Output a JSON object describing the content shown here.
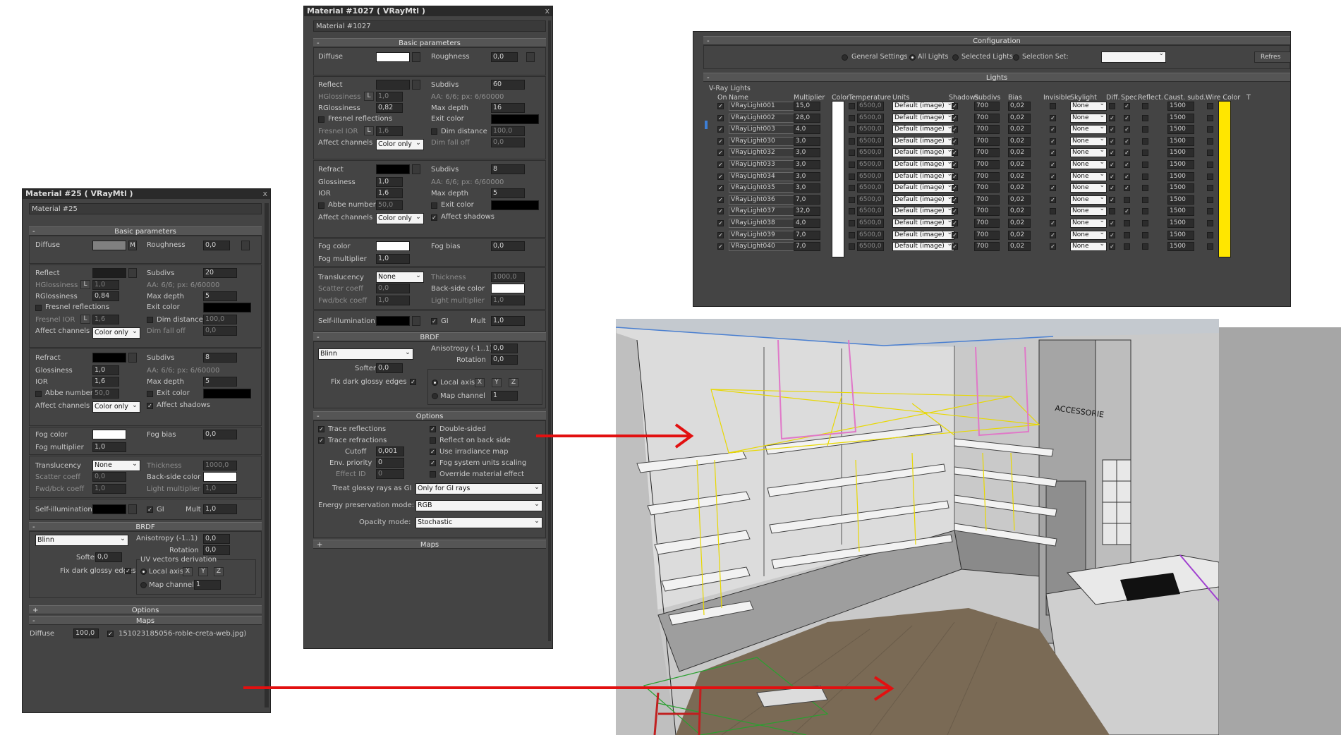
{
  "material25": {
    "title": "Material #25  ( VRayMtl )",
    "close": "x",
    "name": "Material #25",
    "basic_parameters": "Basic parameters",
    "diffuse": "Diffuse",
    "diffuse_map": "M",
    "roughness": "Roughness",
    "roughness_val": "0,0",
    "reflect": "Reflect",
    "subdivs": "Subdivs",
    "subdivs_val": "20",
    "hglossiness": "HGlossiness",
    "lock": "L",
    "hglossiness_val": "1,0",
    "aa": "AA: 6/6; px: 6/60000",
    "rglossiness": "RGlossiness",
    "rglossiness_val": "0,84",
    "max_depth": "Max depth",
    "max_depth_val": "5",
    "fresnel": "Fresnel reflections",
    "exit_color": "Exit color",
    "fresnel_ior": "Fresnel IOR",
    "fresnel_ior_val": "1,6",
    "dim_distance": "Dim distance",
    "dim_distance_val": "100,0",
    "affect_channels": "Affect channels",
    "affect_channels_val": "Color only",
    "dim_fall_off": "Dim fall off",
    "dim_fall_off_val": "0,0",
    "refract": "Refract",
    "r_subdivs_val": "8",
    "glossiness": "Glossiness",
    "glossiness_val": "1,0",
    "r_aa": "AA: 6/6; px: 6/60000",
    "ior": "IOR",
    "ior_val": "1,6",
    "r_max_depth_val": "5",
    "abbe": "Abbe number",
    "abbe_val": "50,0",
    "r_exit_color": "Exit color",
    "r_affect_channels_val": "Color only",
    "affect_shadows": "Affect shadows",
    "fog_color": "Fog color",
    "fog_bias": "Fog bias",
    "fog_bias_val": "0,0",
    "fog_multiplier": "Fog multiplier",
    "fog_multiplier_val": "1,0",
    "translucency": "Translucency",
    "translucency_val": "None",
    "thickness": "Thickness",
    "thickness_val": "1000,0",
    "scatter": "Scatter coeff",
    "scatter_val": "0,0",
    "backside": "Back-side color",
    "fwdbck": "Fwd/bck coeff",
    "fwdbck_val": "1,0",
    "light_mult": "Light multiplier",
    "light_mult_val": "1,0",
    "selfillum": "Self-illumination",
    "gi": "GI",
    "mult": "Mult",
    "mult_val": "1,0",
    "brdf": "BRDF",
    "brdf_type": "Blinn",
    "anisotropy": "Anisotropy (-1..1)",
    "anisotropy_val": "0,0",
    "rotation": "Rotation",
    "rotation_val": "0,0",
    "soften": "Soften",
    "soften_val": "0,0",
    "uv_vectors": "UV vectors derivation",
    "fix_dark": "Fix dark glossy edges",
    "local_axis": "Local axis",
    "x": "X",
    "y": "Y",
    "z": "Z",
    "map_channel": "Map channel",
    "map_channel_val": "1",
    "options": "Options",
    "maps": "Maps",
    "maps_diffuse": "Diffuse",
    "maps_diffuse_amount": "100,0",
    "maps_diffuse_file": "151023185056-roble-creta-web.jpg)",
    "plus": "+",
    "minus": "-"
  },
  "material1027": {
    "title": "Material #1027  ( VRayMtl )",
    "close": "x",
    "name": "Material #1027",
    "basic_parameters": "Basic parameters",
    "diffuse": "Diffuse",
    "roughness": "Roughness",
    "roughness_val": "0,0",
    "reflect": "Reflect",
    "subdivs": "Subdivs",
    "subdivs_val": "60",
    "hglossiness": "HGlossiness",
    "lock": "L",
    "hglossiness_val": "1,0",
    "aa": "AA: 6/6; px: 6/60000",
    "rglossiness": "RGlossiness",
    "rglossiness_val": "0,82",
    "max_depth": "Max depth",
    "max_depth_val": "16",
    "fresnel": "Fresnel reflections",
    "exit_color": "Exit color",
    "fresnel_ior": "Fresnel IOR",
    "fresnel_ior_val": "1,6",
    "dim_distance": "Dim distance",
    "dim_distance_val": "100,0",
    "affect_channels": "Affect channels",
    "affect_channels_val": "Color only",
    "dim_fall_off": "Dim fall off",
    "dim_fall_off_val": "0,0",
    "refract": "Refract",
    "r_subdivs_val": "8",
    "glossiness": "Glossiness",
    "glossiness_val": "1,0",
    "r_aa": "AA: 6/6; px: 6/60000",
    "ior": "IOR",
    "ior_val": "1,6",
    "r_max_depth_val": "5",
    "abbe": "Abbe number",
    "abbe_val": "50,0",
    "r_exit_color": "Exit color",
    "r_affect_channels_val": "Color only",
    "affect_shadows": "Affect shadows",
    "fog_color": "Fog color",
    "fog_bias": "Fog bias",
    "fog_bias_val": "0,0",
    "fog_multiplier": "Fog multiplier",
    "fog_multiplier_val": "1,0",
    "translucency": "Translucency",
    "translucency_val": "None",
    "thickness": "Thickness",
    "thickness_val": "1000,0",
    "scatter": "Scatter coeff",
    "scatter_val": "0,0",
    "backside": "Back-side color",
    "fwdbck": "Fwd/bck coeff",
    "fwdbck_val": "1,0",
    "light_mult": "Light multiplier",
    "light_mult_val": "1,0",
    "selfillum": "Self-illumination",
    "gi": "GI",
    "mult": "Mult",
    "mult_val": "1,0",
    "brdf": "BRDF",
    "brdf_type": "Blinn",
    "anisotropy": "Anisotropy (-1..1)",
    "anisotropy_val": "0,0",
    "rotation": "Rotation",
    "rotation_val": "0,0",
    "soften": "Soften",
    "soften_val": "0,0",
    "fix_dark": "Fix dark glossy edges",
    "local_axis": "Local axis",
    "x": "X",
    "y": "Y",
    "z": "Z",
    "map_channel": "Map channel",
    "map_channel_val": "1",
    "options": "Options",
    "trace_reflections": "Trace reflections",
    "double_sided": "Double-sided",
    "trace_refractions": "Trace refractions",
    "reflect_back": "Reflect on back side",
    "cutoff": "Cutoff",
    "cutoff_val": "0,001",
    "use_irradiance": "Use irradiance map",
    "env_priority": "Env. priority",
    "env_priority_val": "0",
    "fog_units": "Fog system units scaling",
    "effect_id": "Effect ID",
    "effect_id_val": "0",
    "override_effect": "Override material effect",
    "treat_glossy": "Treat glossy rays as GI",
    "treat_glossy_val": "Only for GI rays",
    "energy": "Energy preservation mode:",
    "energy_val": "RGB",
    "opacity": "Opacity mode:",
    "opacity_val": "Stochastic",
    "maps": "Maps",
    "plus": "+",
    "minus": "-"
  },
  "lights": {
    "configuration": "Configuration",
    "radio_general": "General Settings",
    "radio_all": "All Lights",
    "radio_selected": "Selected Lights",
    "radio_selset": "Selection Set:",
    "refresh": "Refres",
    "lights_header": "Lights",
    "vray_lights": "V-Ray Lights",
    "col_on": "On",
    "col_name": "Name",
    "col_multiplier": "Multiplier",
    "col_color": "Color",
    "col_temperature": "Temperature",
    "col_units": "Units",
    "col_shadows": "Shadows",
    "col_subdivs": "Subdivs",
    "col_bias": "Bias",
    "col_invisible": "Invisible",
    "col_skylight": "Skylight",
    "col_diff": "Diff.",
    "col_spec": "Spec.",
    "col_reflect": "Reflect.",
    "col_caust": "Caust. subd.",
    "col_wire": "Wire Color",
    "col_t": "T",
    "minus": "-",
    "rows": [
      {
        "name": "VRayLight001",
        "mult": "15,0",
        "temp": "6500,0",
        "units": "Default (image)",
        "subdivs": "700",
        "bias": "0,02",
        "invisible": false,
        "skylight": "None",
        "diff": false,
        "spec": true,
        "caust": "1500"
      },
      {
        "name": "VRayLight002",
        "mult": "28,0",
        "temp": "6500,0",
        "units": "Default (image)",
        "subdivs": "700",
        "bias": "0,02",
        "invisible": true,
        "skylight": "None",
        "diff": true,
        "spec": true,
        "caust": "1500"
      },
      {
        "name": "VRayLight003",
        "mult": "4,0",
        "temp": "6500,0",
        "units": "Default (image)",
        "subdivs": "700",
        "bias": "0,02",
        "invisible": true,
        "skylight": "None",
        "diff": true,
        "spec": true,
        "caust": "1500"
      },
      {
        "name": "VRayLight030",
        "mult": "3,0",
        "temp": "6500,0",
        "units": "Default (image)",
        "subdivs": "700",
        "bias": "0,02",
        "invisible": true,
        "skylight": "None",
        "diff": true,
        "spec": true,
        "caust": "1500"
      },
      {
        "name": "VRayLight032",
        "mult": "3,0",
        "temp": "6500,0",
        "units": "Default (image)",
        "subdivs": "700",
        "bias": "0,02",
        "invisible": true,
        "skylight": "None",
        "diff": true,
        "spec": true,
        "caust": "1500"
      },
      {
        "name": "VRayLight033",
        "mult": "3,0",
        "temp": "6500,0",
        "units": "Default (image)",
        "subdivs": "700",
        "bias": "0,02",
        "invisible": true,
        "skylight": "None",
        "diff": true,
        "spec": true,
        "caust": "1500"
      },
      {
        "name": "VRayLight034",
        "mult": "3,0",
        "temp": "6500,0",
        "units": "Default (image)",
        "subdivs": "700",
        "bias": "0,02",
        "invisible": true,
        "skylight": "None",
        "diff": true,
        "spec": true,
        "caust": "1500"
      },
      {
        "name": "VRayLight035",
        "mult": "3,0",
        "temp": "6500,0",
        "units": "Default (image)",
        "subdivs": "700",
        "bias": "0,02",
        "invisible": true,
        "skylight": "None",
        "diff": true,
        "spec": true,
        "caust": "1500"
      },
      {
        "name": "VRayLight036",
        "mult": "7,0",
        "temp": "6500,0",
        "units": "Default (image)",
        "subdivs": "700",
        "bias": "0,02",
        "invisible": true,
        "skylight": "None",
        "diff": true,
        "spec": false,
        "caust": "1500"
      },
      {
        "name": "VRayLight037",
        "mult": "32,0",
        "temp": "6500,0",
        "units": "Default (image)",
        "subdivs": "700",
        "bias": "0,02",
        "invisible": false,
        "skylight": "None",
        "diff": false,
        "spec": true,
        "caust": "1500"
      },
      {
        "name": "VRayLight038",
        "mult": "4,0",
        "temp": "6500,0",
        "units": "Default (image)",
        "subdivs": "700",
        "bias": "0,02",
        "invisible": true,
        "skylight": "None",
        "diff": true,
        "spec": false,
        "caust": "1500"
      },
      {
        "name": "VRayLight039",
        "mult": "7,0",
        "temp": "6500,0",
        "units": "Default (image)",
        "subdivs": "700",
        "bias": "0,02",
        "invisible": true,
        "skylight": "None",
        "diff": true,
        "spec": false,
        "caust": "1500"
      },
      {
        "name": "VRayLight040",
        "mult": "7,0",
        "temp": "6500,0",
        "units": "Default (image)",
        "subdivs": "700",
        "bias": "0,02",
        "invisible": true,
        "skylight": "None",
        "diff": true,
        "spec": false,
        "caust": "1500"
      }
    ],
    "wire_color": "#ffe600"
  },
  "viewport": {
    "store_sign": "ACCESSORIE"
  },
  "colors": {
    "arrow": "#e21010"
  }
}
